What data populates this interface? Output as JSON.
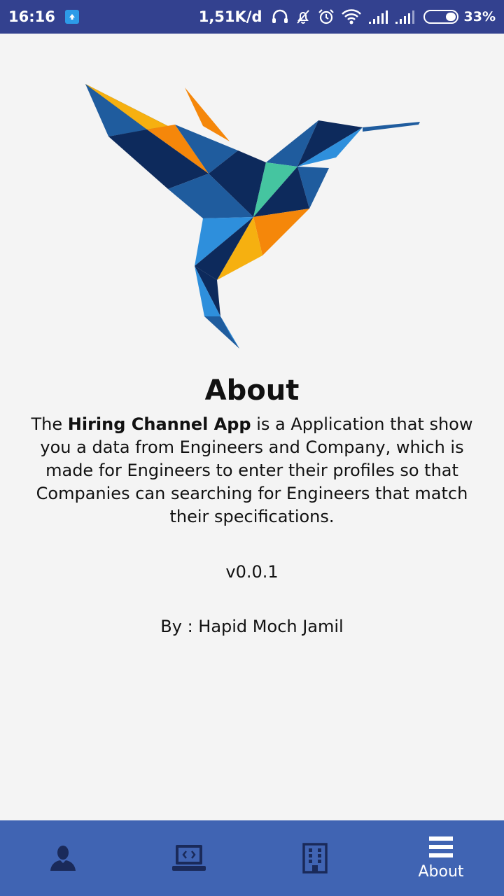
{
  "status_bar": {
    "time": "16:16",
    "net_speed": "1,51K/d",
    "battery_pct": "33%"
  },
  "about": {
    "title": "About",
    "desc_prefix": "The ",
    "app_name": "Hiring Channel App",
    "desc_rest": " is a Application that show you a data from Engineers and Company, which is made for Engineers to enter their profiles so that Companies can searching for Engineers that match their specifications.",
    "version": "v0.0.1",
    "author": "By : Hapid Moch Jamil"
  },
  "bottom_nav": {
    "items": [
      {
        "icon": "person-icon",
        "label": ""
      },
      {
        "icon": "laptop-code-icon",
        "label": ""
      },
      {
        "icon": "building-icon",
        "label": ""
      },
      {
        "icon": "menu-icon",
        "label": "About"
      }
    ]
  },
  "colors": {
    "status_bar": "#33418f",
    "bottom_nav": "#4064b3",
    "nav_icon": "#1a2a5a",
    "background": "#f4f4f4"
  }
}
